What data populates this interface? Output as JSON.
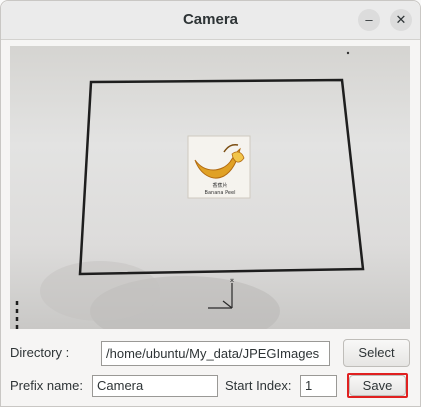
{
  "window": {
    "title": "Camera",
    "minimize_glyph": "–",
    "close_glyph": "✕"
  },
  "preview": {
    "photo_caption_top": "香蕉片",
    "photo_caption_bottom": "Banana Peel"
  },
  "directory": {
    "label": "Directory :",
    "value": "/home/ubuntu/My_data/JPEGImages",
    "button_label": "Select"
  },
  "prefix": {
    "label": "Prefix name:",
    "value": "Camera"
  },
  "start_index": {
    "label": "Start Index:",
    "value": "1"
  },
  "save": {
    "button_label": "Save",
    "highlight_color": "#e02020"
  }
}
